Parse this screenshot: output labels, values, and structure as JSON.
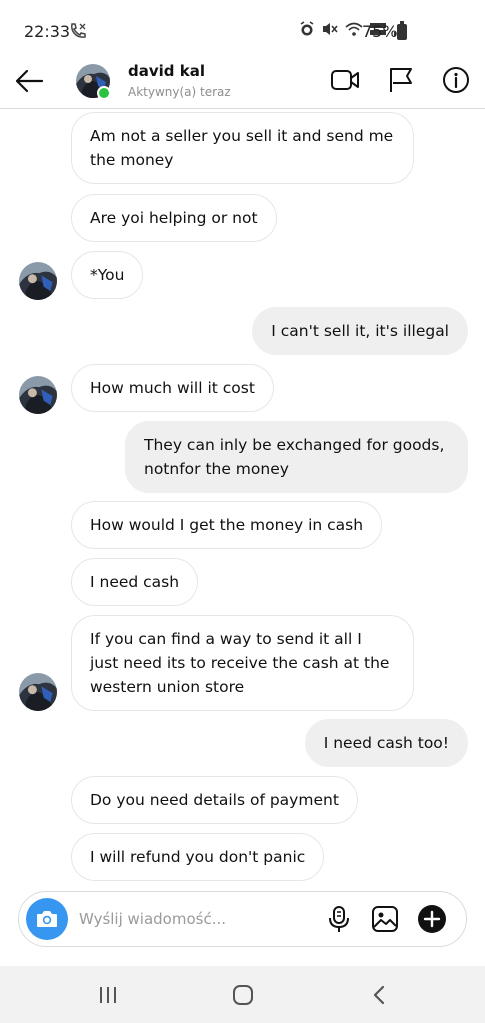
{
  "status_bar": {
    "time": "22:33",
    "battery": "75%",
    "icons": [
      "call-icon",
      "alarm-icon",
      "mute-icon",
      "wifi-icon",
      "volte-icon",
      "signal-icon",
      "battery-icon"
    ]
  },
  "header": {
    "contact_name": "david kal",
    "contact_status": "Aktywny(a) teraz",
    "online_color": "#2bc23f",
    "actions": [
      "video-call-icon",
      "flag-icon",
      "info-icon"
    ]
  },
  "messages": [
    {
      "direction": "in",
      "text": "Am not a seller you sell it and send me\nthe money",
      "avatar": false
    },
    {
      "direction": "in",
      "text": "Are yoi helping or not",
      "avatar": false
    },
    {
      "direction": "in",
      "text": "*You",
      "avatar": true
    },
    {
      "direction": "out",
      "text": "I can't sell it, it's illegal"
    },
    {
      "direction": "in",
      "text": "How much will it cost",
      "avatar": true
    },
    {
      "direction": "out",
      "text": "They can inly be exchanged for goods,\nnotnfor the money"
    },
    {
      "direction": "in",
      "text": "How would I get the money in cash",
      "avatar": false
    },
    {
      "direction": "in",
      "text": "I need cash",
      "avatar": false
    },
    {
      "direction": "in",
      "text": "If you can find a way to send it all I\njust need its to receive the cash at the\nwestern union store",
      "avatar": true
    },
    {
      "direction": "out",
      "text": "I need cash too!"
    },
    {
      "direction": "in",
      "text": "Do you need details of payment",
      "avatar": false
    },
    {
      "direction": "in",
      "text": "I will refund you don't panic",
      "avatar": false
    }
  ],
  "composer": {
    "placeholder": "Wyślij wiadomość...",
    "value": "",
    "accent": "#3797f0",
    "icons": [
      "camera-icon",
      "microphone-icon",
      "gallery-icon",
      "add-icon"
    ]
  },
  "nav_bar": {
    "icons": [
      "recent-apps-icon",
      "home-icon",
      "back-nav-icon"
    ]
  }
}
